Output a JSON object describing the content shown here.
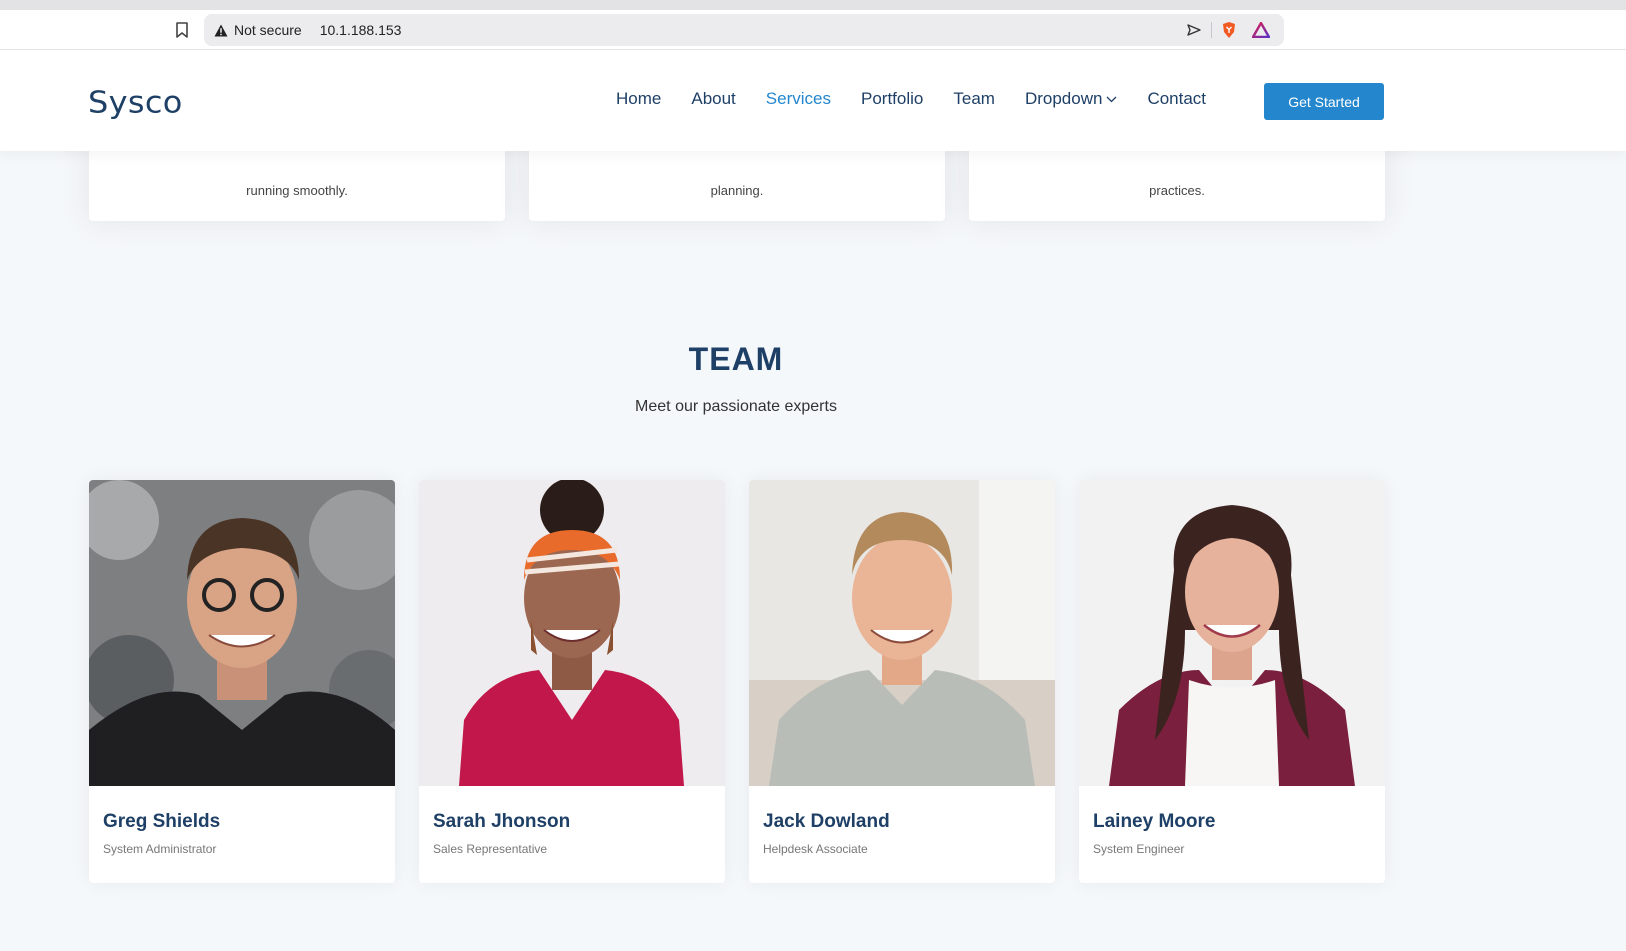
{
  "browser": {
    "security_label": "Not secure",
    "url": "10.1.188.153",
    "icons": [
      "bookmark-icon",
      "warning-icon",
      "send-icon",
      "brave-shield-icon",
      "brave-rewards-icon"
    ]
  },
  "site": {
    "logo": "Sysco",
    "nav": [
      {
        "label": "Home"
      },
      {
        "label": "About"
      },
      {
        "label": "Services",
        "active": true
      },
      {
        "label": "Portfolio"
      },
      {
        "label": "Team"
      },
      {
        "label": "Dropdown"
      },
      {
        "label": "Contact"
      }
    ],
    "cta": "Get Started"
  },
  "services": {
    "cards": [
      {
        "text_tail": "running smoothly."
      },
      {
        "text_tail": "planning."
      },
      {
        "text_tail": "practices."
      }
    ]
  },
  "team": {
    "title": "TEAM",
    "subtitle": "Meet our passionate experts",
    "members": [
      {
        "name": "Greg Shields",
        "role": "System Administrator"
      },
      {
        "name": "Sarah Jhonson",
        "role": "Sales Representative"
      },
      {
        "name": "Jack Dowland",
        "role": "Helpdesk Associate"
      },
      {
        "name": "Lainey Moore",
        "role": "System Engineer"
      }
    ]
  },
  "colors": {
    "brand": "#1e3f66",
    "accent": "#2487ce",
    "background": "#f5f8fb"
  }
}
